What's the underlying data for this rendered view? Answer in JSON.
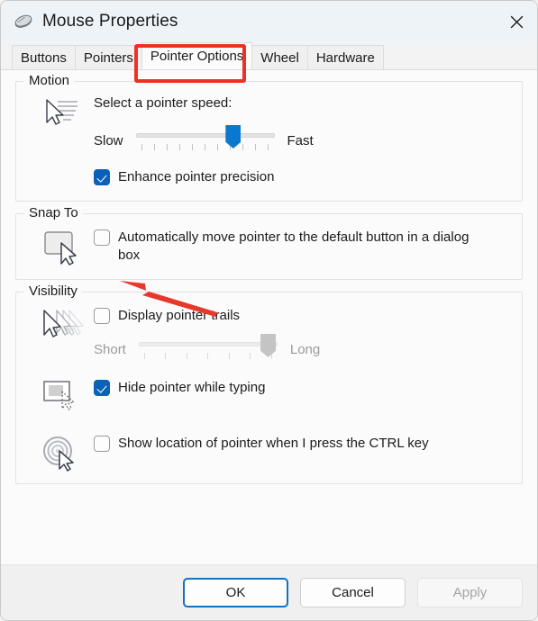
{
  "window": {
    "title": "Mouse Properties",
    "icon": "mouse-icon",
    "close_label": "Close"
  },
  "tabs": [
    {
      "label": "Buttons",
      "selected": false
    },
    {
      "label": "Pointers",
      "selected": false
    },
    {
      "label": "Pointer Options",
      "selected": true
    },
    {
      "label": "Wheel",
      "selected": false
    },
    {
      "label": "Hardware",
      "selected": false
    }
  ],
  "annotations": {
    "tab_highlight_color": "#ee3124",
    "arrow_color": "#e8382b",
    "arrow_target": "Enhance pointer precision"
  },
  "groups": {
    "motion": {
      "title": "Motion",
      "icon": "pointer-speed-icon",
      "speed_label": "Select a pointer speed:",
      "slider": {
        "min_label": "Slow",
        "max_label": "Fast",
        "value_percent": 70,
        "tick_count": 11,
        "enabled": true
      },
      "enhance_precision": {
        "label": "Enhance pointer precision",
        "checked": true
      }
    },
    "snap_to": {
      "title": "Snap To",
      "icon": "snap-to-button-icon",
      "auto_move": {
        "label": "Automatically move pointer to the default button in a dialog box",
        "checked": false
      }
    },
    "visibility": {
      "title": "Visibility",
      "trails": {
        "icon": "pointer-trails-icon",
        "label": "Display pointer trails",
        "checked": false,
        "slider": {
          "min_label": "Short",
          "max_label": "Long",
          "value_percent": 93,
          "tick_count": 7,
          "enabled": false
        }
      },
      "hide_while_typing": {
        "icon": "hide-pointer-icon",
        "label": "Hide pointer while typing",
        "checked": true
      },
      "show_location": {
        "icon": "locate-pointer-icon",
        "label": "Show location of pointer when I press the CTRL key",
        "checked": false
      }
    }
  },
  "footer": {
    "ok_label": "OK",
    "cancel_label": "Cancel",
    "apply_label": "Apply",
    "apply_enabled": false,
    "default_button": "OK"
  },
  "colors": {
    "accent": "#0b61b8",
    "slider_thumb": "#0b78d0",
    "annotation_red": "#ee3124",
    "titlebar_bg": "#eef3f7",
    "content_bg": "#fbfbfb"
  }
}
